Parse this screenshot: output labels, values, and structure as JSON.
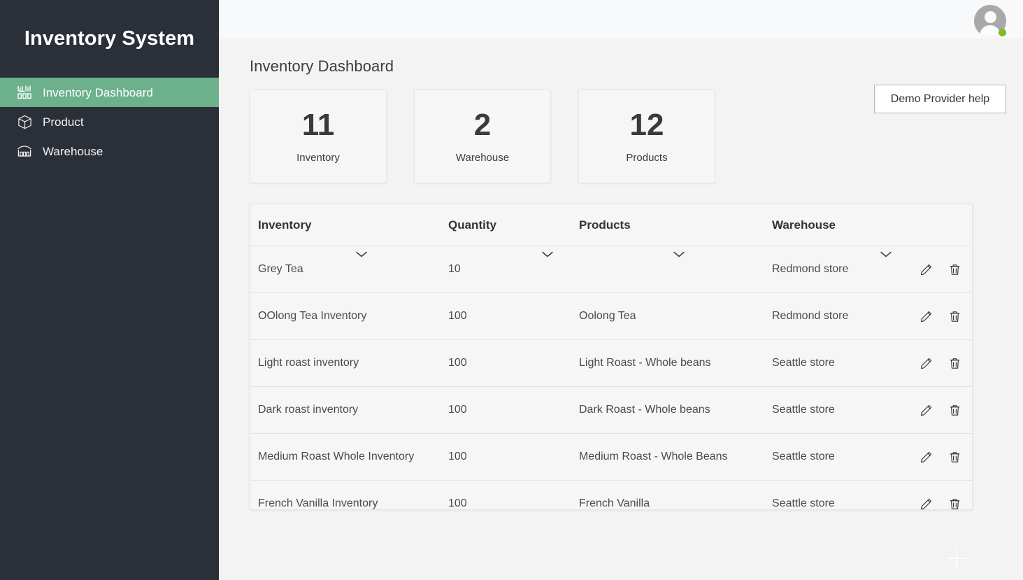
{
  "sidebar": {
    "brand": "Inventory System",
    "items": [
      {
        "label": "Inventory Dashboard",
        "icon": "dashboard-chart-icon",
        "active": true
      },
      {
        "label": "Product",
        "icon": "box-icon",
        "active": false
      },
      {
        "label": "Warehouse",
        "icon": "warehouse-icon",
        "active": false
      }
    ]
  },
  "topbar": {
    "avatar": "user-avatar",
    "status": "online"
  },
  "main": {
    "page_title": "Inventory Dashboard",
    "help_button": "Demo Provider help",
    "stats": [
      {
        "value": "11",
        "label": "Inventory"
      },
      {
        "value": "2",
        "label": "Warehouse"
      },
      {
        "value": "12",
        "label": "Products"
      }
    ],
    "table": {
      "columns": [
        "Inventory",
        "Quantity",
        "Products",
        "Warehouse"
      ],
      "sort_icon": "chevron-down-icon",
      "edit_icon": "pencil-icon",
      "delete_icon": "trash-icon",
      "rows": [
        {
          "inventory": "Grey Tea",
          "quantity": "10",
          "products": "",
          "warehouse": "Redmond store"
        },
        {
          "inventory": "OOlong Tea Inventory",
          "quantity": "100",
          "products": "Oolong Tea",
          "warehouse": "Redmond store"
        },
        {
          "inventory": "Light roast inventory",
          "quantity": "100",
          "products": "Light Roast - Whole beans",
          "warehouse": "Seattle store"
        },
        {
          "inventory": "Dark roast inventory",
          "quantity": "100",
          "products": "Dark Roast - Whole beans",
          "warehouse": "Seattle store"
        },
        {
          "inventory": "Medium Roast Whole Inventory",
          "quantity": "100",
          "products": "Medium Roast - Whole Beans",
          "warehouse": "Seattle store"
        },
        {
          "inventory": "French Vanilla Inventory",
          "quantity": "100",
          "products": "French Vanilla",
          "warehouse": "Seattle store"
        }
      ]
    },
    "add_button": "add-icon"
  },
  "colors": {
    "sidebar_bg": "#2b3038",
    "accent_green": "#6cb08c",
    "status_green": "#7fba27",
    "page_bg": "#f3f3f3",
    "card_bg": "#f6f6f6"
  }
}
